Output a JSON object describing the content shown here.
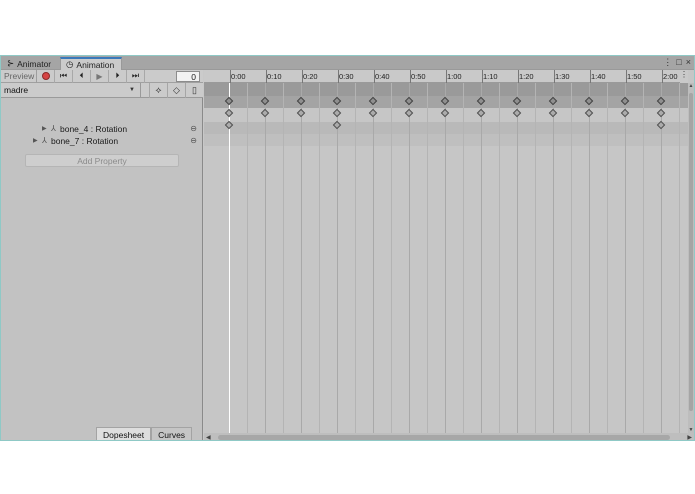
{
  "tabs": [
    {
      "label": "Animator",
      "icon": "animator-icon"
    },
    {
      "label": "Animation",
      "icon": "animation-clock-icon",
      "active": true
    }
  ],
  "window_icons": [
    "kebab-menu-icon",
    "maximize-icon",
    "close-icon"
  ],
  "controls": {
    "preview_label": "Preview",
    "buttons": [
      "record-icon",
      "first-key-icon",
      "prev-key-icon",
      "play-icon",
      "next-key-icon",
      "last-key-icon"
    ],
    "frame_value": "0"
  },
  "clip": {
    "selected": "madre",
    "tool_icons": [
      "add-keyframe-icon",
      "add-event-icon",
      "filter-icon"
    ]
  },
  "properties": [
    {
      "label": "bone_4 : Rotation",
      "keys_at": [
        0,
        10,
        20,
        30,
        40,
        50,
        60,
        70,
        80,
        90,
        100,
        110,
        120
      ]
    },
    {
      "label": "bone_7 : Rotation",
      "keys_at": [
        0,
        30,
        120
      ]
    }
  ],
  "summary_keys_at": [
    0,
    10,
    20,
    30,
    40,
    50,
    60,
    70,
    80,
    90,
    100,
    110,
    120
  ],
  "add_property_label": "Add Property",
  "bottom_tabs": [
    {
      "label": "Dopesheet",
      "active": true
    },
    {
      "label": "Curves",
      "active": false
    }
  ],
  "ruler": {
    "labels": [
      "0:00",
      "0:10",
      "0:20",
      "0:30",
      "0:40",
      "0:50",
      "1:00",
      "1:10",
      "1:20",
      "1:30",
      "1:40",
      "1:50",
      "2:00"
    ],
    "frames": [
      0,
      10,
      20,
      30,
      40,
      50,
      60,
      70,
      80,
      90,
      100,
      110,
      120
    ]
  },
  "playhead_frame": 0
}
